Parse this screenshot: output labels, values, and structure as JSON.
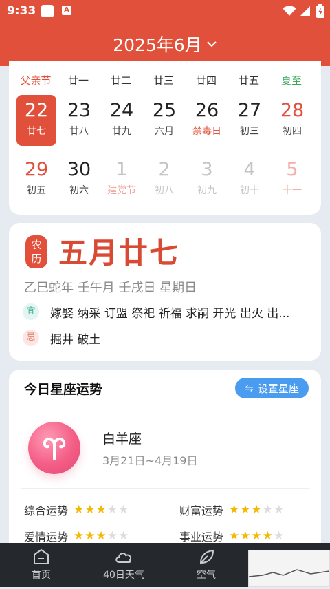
{
  "status_bar": {
    "time": "9:33",
    "a_icon_text": "A"
  },
  "header": {
    "title": "2025年6月",
    "dropdown_icon": "chevron-down-icon"
  },
  "calendar": {
    "header_row": [
      {
        "text": "父亲节",
        "color": "red"
      },
      {
        "text": "廿一",
        "color": "normal"
      },
      {
        "text": "廿二",
        "color": "normal"
      },
      {
        "text": "廿三",
        "color": "normal"
      },
      {
        "text": "廿四",
        "color": "normal"
      },
      {
        "text": "廿五",
        "color": "normal"
      },
      {
        "text": "夏至",
        "color": "green"
      }
    ],
    "week1": [
      {
        "num": "22",
        "lunar": "廿七"
      },
      {
        "num": "23",
        "lunar": "廿八"
      },
      {
        "num": "24",
        "lunar": "廿九"
      },
      {
        "num": "25",
        "lunar": "六月"
      },
      {
        "num": "26",
        "lunar": "禁毒日"
      },
      {
        "num": "27",
        "lunar": "初三"
      },
      {
        "num": "28",
        "lunar": "初四"
      }
    ],
    "week2": [
      {
        "num": "29",
        "lunar": "初五"
      },
      {
        "num": "30",
        "lunar": "初六"
      },
      {
        "num": "1",
        "lunar": "建党节"
      },
      {
        "num": "2",
        "lunar": "初八"
      },
      {
        "num": "3",
        "lunar": "初九"
      },
      {
        "num": "4",
        "lunar": "初十"
      },
      {
        "num": "5",
        "lunar": "十一"
      }
    ]
  },
  "lunar_card": {
    "badge_line1": "农",
    "badge_line2": "历",
    "title": "五月廿七",
    "ganzhi": "乙巳蛇年 壬午月 壬戌日 星期日",
    "yi_label": "宜",
    "yi_text": "嫁娶 纳采 订盟 祭祀 祈福 求嗣 开光 出火 出...",
    "ji_label": "忌",
    "ji_text": "掘井 破土"
  },
  "horoscope": {
    "title": "今日星座运势",
    "set_button": "设置星座",
    "sign_name": "白羊座",
    "sign_range": "3月21日~4月19日",
    "fortunes": [
      {
        "label": "综合运势",
        "stars": 3
      },
      {
        "label": "财富运势",
        "stars": 3
      },
      {
        "label": "爱情运势",
        "stars": 3
      },
      {
        "label": "事业运势",
        "stars": 4
      }
    ]
  },
  "tabbar": {
    "items": [
      {
        "label": "首页",
        "icon": "home-icon"
      },
      {
        "label": "40日天气",
        "icon": "cloud-icon"
      },
      {
        "label": "空气",
        "icon": "leaf-icon"
      }
    ]
  },
  "colors": {
    "primary": "#e0503a",
    "festival_green": "#3aa85a",
    "button_blue": "#4a9cf0",
    "star": "#f5b800",
    "tabbar_bg": "#25282d"
  }
}
